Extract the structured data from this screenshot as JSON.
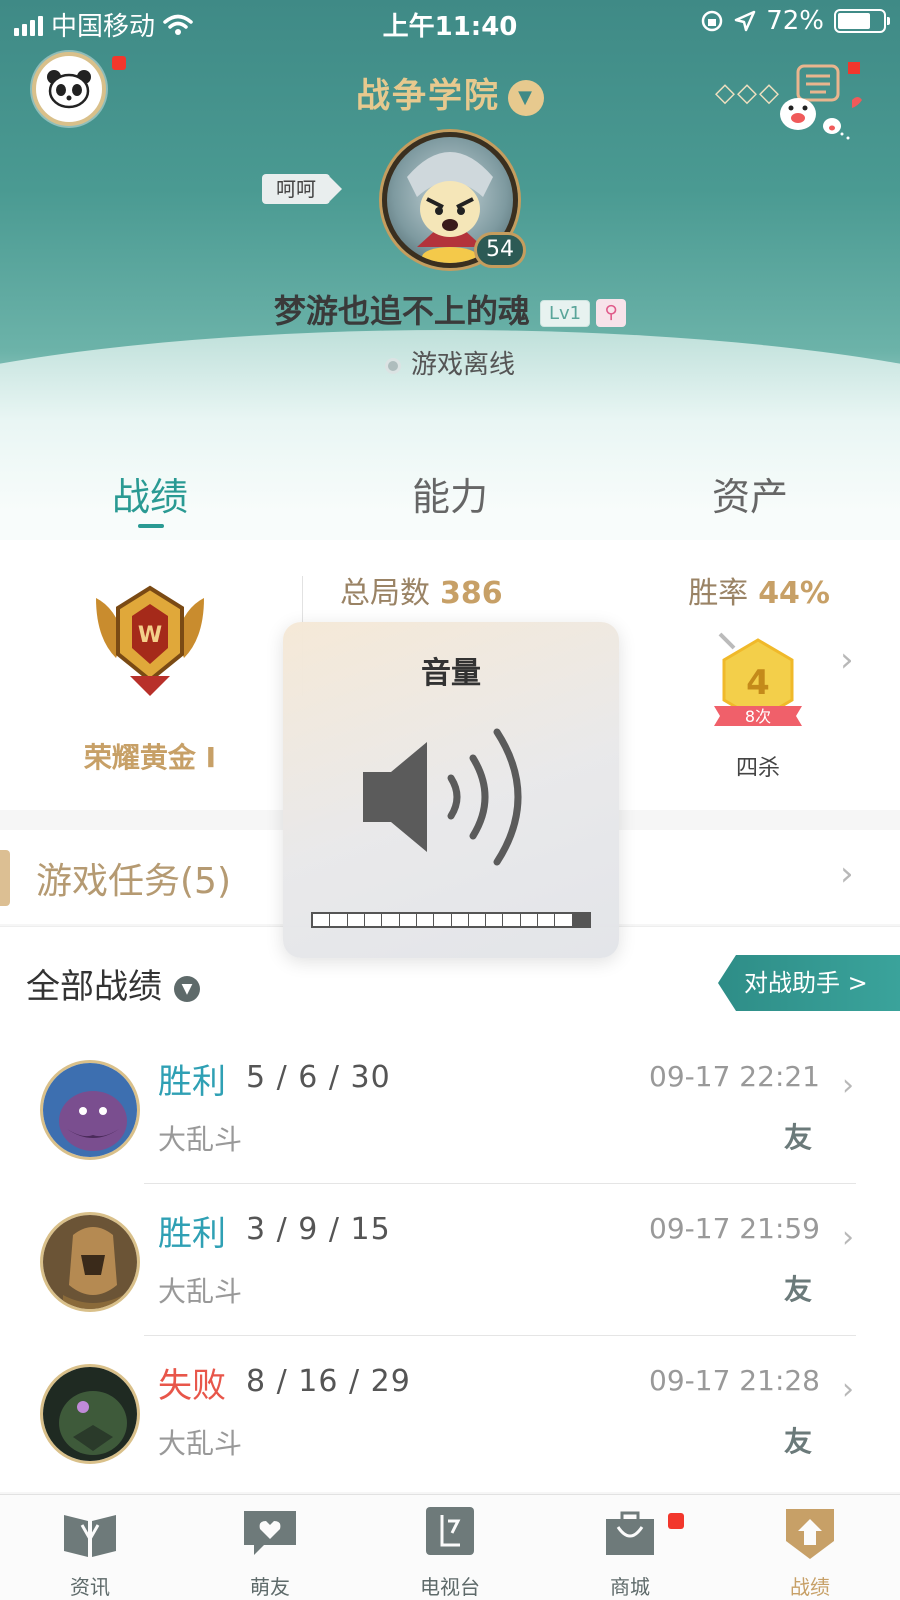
{
  "status_bar": {
    "carrier": "中国移动",
    "time": "上午11:40",
    "battery": "72%",
    "battery_level": 0.72
  },
  "header": {
    "academy": "战争学院",
    "nickname_tag": "呵呵",
    "hero_level": "54",
    "username": "梦游也追不上的魂",
    "lv_badge": "Lv1",
    "status": "游戏离线"
  },
  "tabs": [
    {
      "label": "战绩",
      "active": true
    },
    {
      "label": "能力",
      "active": false
    },
    {
      "label": "资产",
      "active": false
    }
  ],
  "stats": {
    "rank": "荣耀黄金 I",
    "total_label": "总局数",
    "total_value": "386",
    "winrate_label": "胜率",
    "winrate_value": "44%",
    "badge_number": "4",
    "badge_count": "8次",
    "badge_label": "四杀"
  },
  "tasks": {
    "label": "游戏任务(5)"
  },
  "records": {
    "title": "全部战绩",
    "assistant_button": "对战助手 >"
  },
  "matches": [
    {
      "result": "胜利",
      "outcome": "win",
      "kda": "5 / 6 / 30",
      "mode": "大乱斗",
      "time": "09-17 22:21",
      "tag": "友"
    },
    {
      "result": "胜利",
      "outcome": "win",
      "kda": "3 / 9 / 15",
      "mode": "大乱斗",
      "time": "09-17 21:59",
      "tag": "友"
    },
    {
      "result": "失败",
      "outcome": "lose",
      "kda": "8 / 16 / 29",
      "mode": "大乱斗",
      "time": "09-17 21:28",
      "tag": "友"
    }
  ],
  "bottom_nav": [
    {
      "label": "资讯",
      "icon": "book-icon",
      "active": false
    },
    {
      "label": "萌友",
      "icon": "heart-chat-icon",
      "active": false
    },
    {
      "label": "电视台",
      "icon": "tv-icon",
      "active": false
    },
    {
      "label": "商城",
      "icon": "bag-icon",
      "active": false
    },
    {
      "label": "战绩",
      "icon": "shield-icon",
      "active": true
    }
  ],
  "volume_hud": {
    "title": "音量",
    "level": 0.94
  },
  "colors": {
    "accent": "#2a9a93",
    "gold": "#c7a067",
    "win": "#2fa0b4",
    "lose": "#e8564a"
  }
}
